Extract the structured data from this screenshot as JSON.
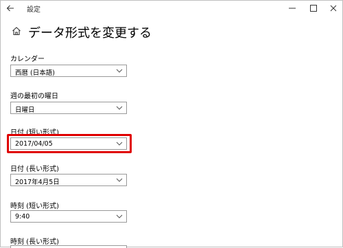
{
  "window": {
    "app_title": "設定",
    "back_icon": "back-arrow-icon",
    "minimize_icon": "minimize-icon",
    "maximize_icon": "maximize-icon",
    "close_icon": "close-icon"
  },
  "page": {
    "home_icon": "home-icon",
    "title": "データ形式を変更する"
  },
  "settings": [
    {
      "label": "カレンダー",
      "value": "西暦 (日本語)"
    },
    {
      "label": "週の最初の曜日",
      "value": "日曜日"
    },
    {
      "label": "日付 (短い形式)",
      "value": "2017/04/05"
    },
    {
      "label": "日付 (長い形式)",
      "value": "2017年4月5日"
    },
    {
      "label": "時刻 (短い形式)",
      "value": "9:40"
    },
    {
      "label": "時刻 (長い形式)",
      "value": ""
    }
  ],
  "highlight": {
    "color": "#e00000",
    "target": "日付 (短い形式)"
  }
}
